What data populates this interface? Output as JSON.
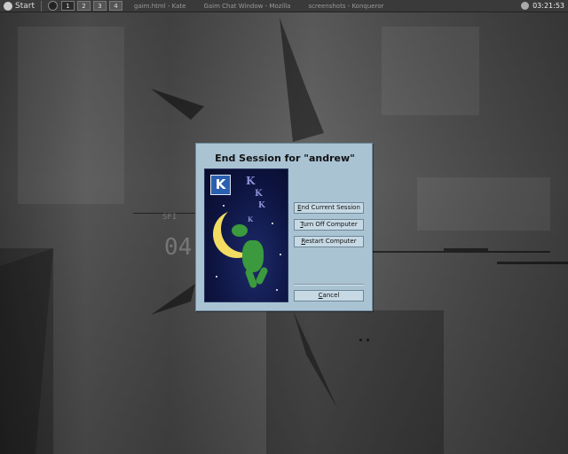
{
  "taskbar": {
    "start_label": "Start",
    "desktops": [
      "1",
      "2",
      "3",
      "4"
    ],
    "tasks": [
      "gaim.html - Kate",
      "Gaim Chat Window - Mozilla",
      "screenshots - Konqueror"
    ],
    "clock": "03:21:53"
  },
  "dialog": {
    "title": "End Session for \"andrew\"",
    "buttons": {
      "end_session": {
        "mnemonic": "E",
        "rest": "nd Current Session"
      },
      "turn_off": {
        "mnemonic": "T",
        "rest": "urn Off Computer"
      },
      "restart": {
        "mnemonic": "R",
        "rest": "estart Computer"
      },
      "cancel": {
        "mnemonic": "C",
        "rest": "ancel"
      }
    },
    "logo_letter": "K",
    "sleep_glyphs": [
      "K",
      "K",
      "K",
      "K"
    ]
  },
  "colors": {
    "dialog_bg": "#a9c3d3",
    "button_bg": "#c6d9e4",
    "moon": "#f2dc62",
    "dragon": "#3b9a3d"
  }
}
